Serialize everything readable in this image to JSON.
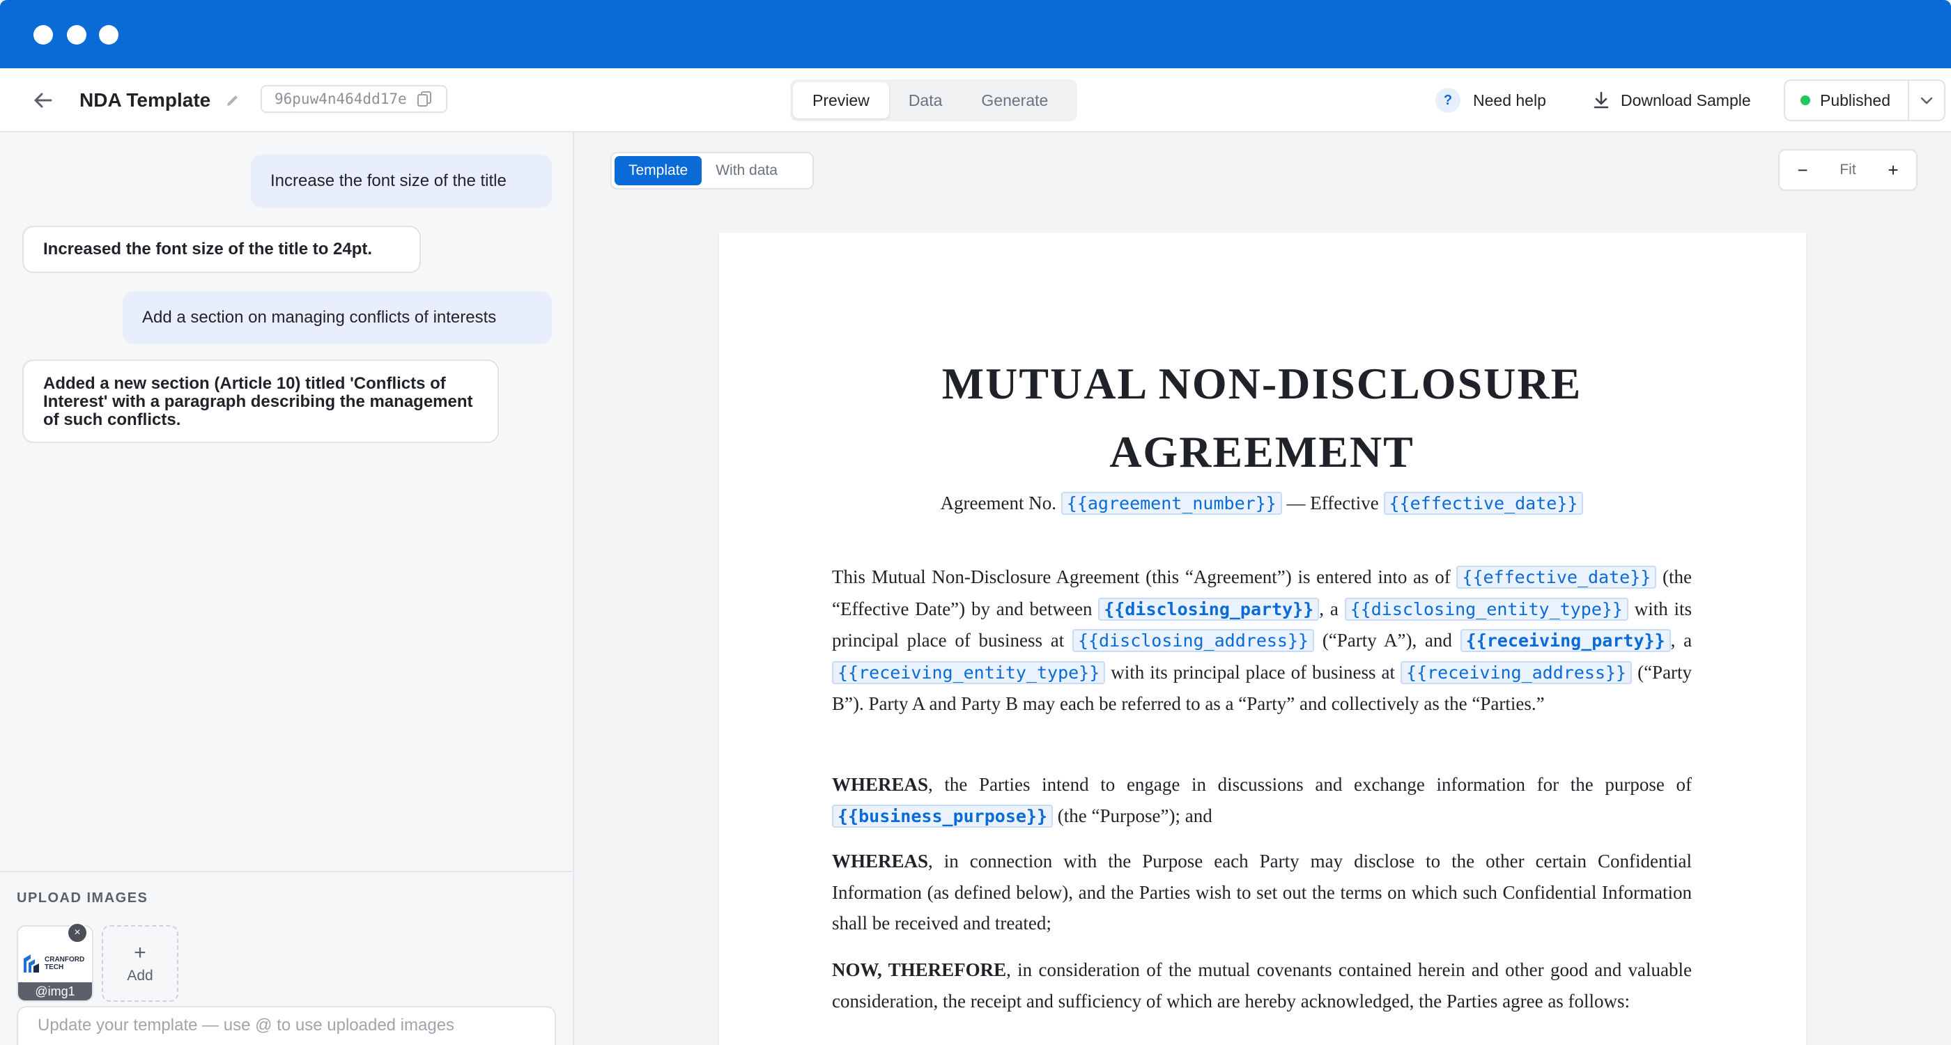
{
  "window": {
    "chrome_color": "#0a6bd6"
  },
  "header": {
    "title": "NDA Template",
    "doc_id": "96puw4n464dd17e",
    "tabs": [
      "Preview",
      "Data",
      "Generate"
    ],
    "active_tab": "Preview",
    "help_label": "Need help",
    "download_label": "Download Sample",
    "status_label": "Published",
    "status_color": "#22c55e"
  },
  "chat": {
    "messages": [
      {
        "role": "user",
        "text": "Increase the font size of the title"
      },
      {
        "role": "assistant",
        "text": "Increased the font size of the title to 24pt."
      },
      {
        "role": "user",
        "text": "Add a section on managing conflicts of interests"
      },
      {
        "role": "assistant",
        "text": "Added a new section (Article 10) titled 'Conflicts of Interest' with a paragraph describing the management of such conflicts."
      }
    ]
  },
  "upload": {
    "label": "UPLOAD IMAGES",
    "images": [
      {
        "caption": "@img1",
        "logo_text_1": "CRANFORD",
        "logo_text_2": "TECH"
      }
    ],
    "add_label": "Add",
    "input_placeholder": "Update your template — use @ to use uploaded images"
  },
  "preview": {
    "mode_tabs": [
      "Template",
      "With data"
    ],
    "active_mode": "Template",
    "zoom_label": "Fit",
    "zoom_out": "−",
    "zoom_in": "+"
  },
  "document": {
    "title_line1": "MUTUAL NON-DISCLOSURE",
    "title_line2": "AGREEMENT",
    "sub_prefix": "Agreement No.",
    "sub_token1": "{{agreement_number}}",
    "sub_mid": "— Effective",
    "sub_token2": "{{effective_date}}",
    "p1": {
      "t0": "This Mutual Non-Disclosure Agreement (this “Agreement”) is entered into as of",
      "k1": "{{effective_date}}",
      "t1": "(the “Effective Date”) by and between",
      "k2": "{{disclosing_party}}",
      "t2": ", a",
      "k3": "{{disclosing_entity_type}}",
      "t3": "with its principal place of business at",
      "k4": "{{disclosing_address}}",
      "t4": "(“Party A”), and",
      "k5": "{{receiving_party}}",
      "t5": ", a",
      "k6": "{{receiving_entity_type}}",
      "t6": "with its principal place of business at",
      "k7": "{{receiving_address}}",
      "t7": "(“Party B”). Party A and Party B may each be referred to as a “Party” and collectively as the “Parties.”"
    },
    "p2": {
      "lead": "WHEREAS",
      "t0": ", the Parties intend to engage in discussions and exchange information for the purpose of",
      "k1": "{{business_purpose}}",
      "t1": "(the “Purpose”); and"
    },
    "p3": {
      "lead": "WHEREAS",
      "t0": ", in connection with the Purpose each Party may disclose to the other certain Confidential Information (as defined below), and the Parties wish to set out the terms on which such Confidential Information shall be received and treated;"
    },
    "p4": {
      "lead": "NOW, THEREFORE",
      "t0": ", in consideration of the mutual covenants contained herein and other good and valuable consideration, the receipt and sufficiency of which are hereby acknowledged, the Parties agree as follows:"
    }
  }
}
